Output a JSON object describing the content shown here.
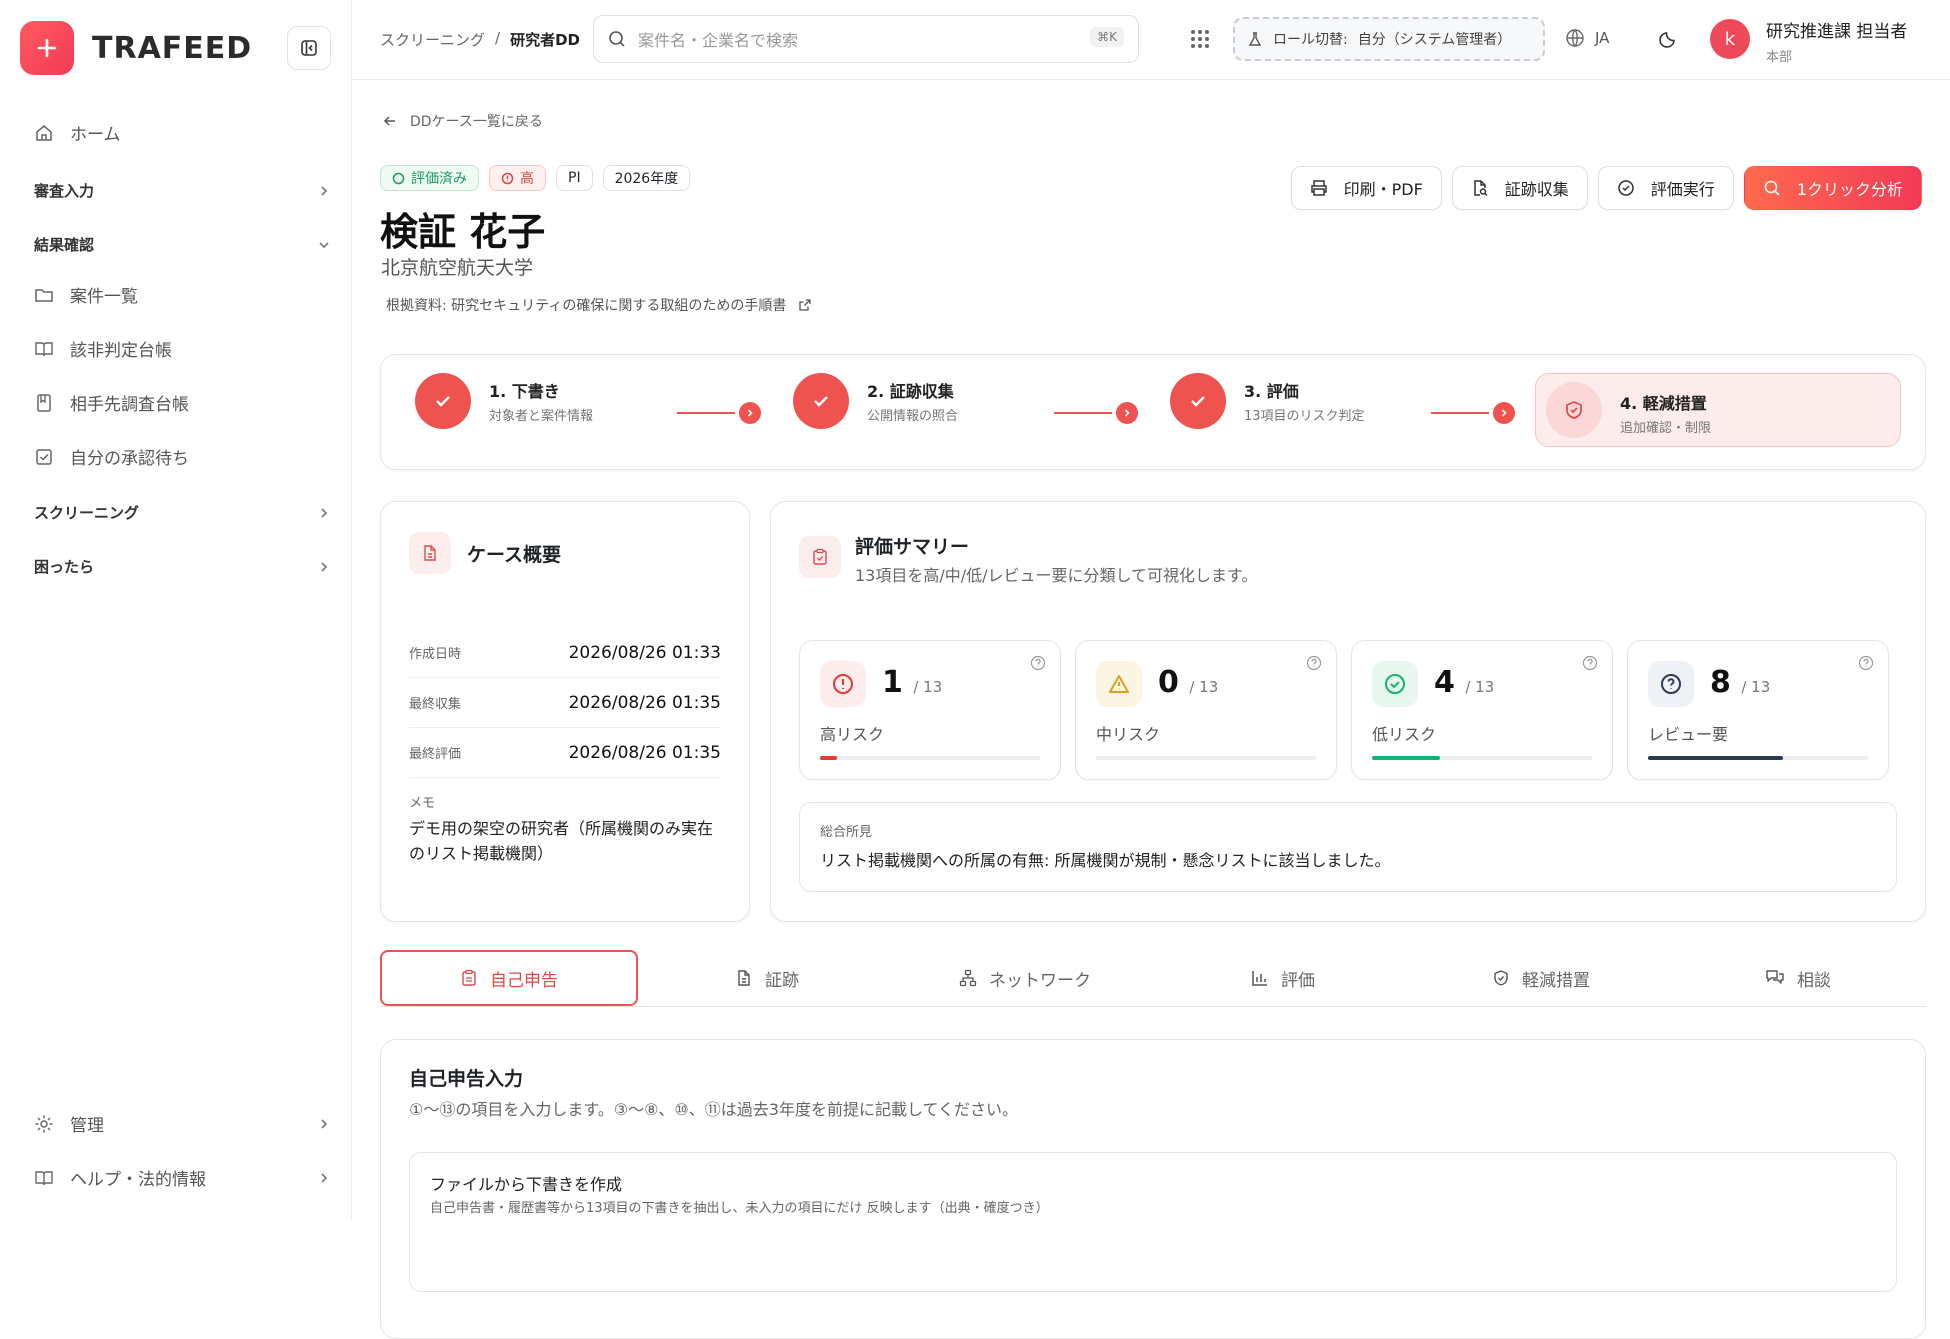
{
  "app": {
    "name": "TRAFEED"
  },
  "sidebar": {
    "home": "ホーム",
    "groups": {
      "review_input": "審査入力",
      "results": "結果確認",
      "screening": "スクリーニング",
      "help_group": "困ったら",
      "admin": "管理",
      "legal": "ヘルプ・法的情報"
    },
    "items": [
      {
        "label": "案件一覧",
        "icon": "folder-icon"
      },
      {
        "label": "該非判定台帳",
        "icon": "book-icon"
      },
      {
        "label": "相手先調査台帳",
        "icon": "ledger-icon"
      },
      {
        "label": "自分の承認待ち",
        "icon": "checkbox-icon"
      }
    ]
  },
  "header": {
    "breadcrumb": [
      "スクリーニング",
      "研究者DD"
    ],
    "breadcrumb_sep": "/",
    "search_placeholder": "案件名・企業名で検索",
    "search_shortcut": "⌘K",
    "role_label": "ロール切替:",
    "role_value": "自分（システム管理者）",
    "lang": "JA",
    "user_initial": "k",
    "user_name": "研究推進課 担当者",
    "user_org": "本部"
  },
  "case": {
    "back_label": "DDケース一覧に戻る",
    "badges": {
      "status": "評価済み",
      "risk": "高",
      "pi": "PI",
      "year": "2026年度"
    },
    "name": "検証 花子",
    "affiliation": "北京航空航天大学",
    "basis": "根拠資料: 研究セキュリティの確保に関する取組のための手順書"
  },
  "actions": {
    "print": "印刷・PDF",
    "collect": "証跡収集",
    "evaluate": "評価実行",
    "analyze": "1クリック分析"
  },
  "steps": [
    {
      "title": "1. 下書き",
      "desc": "対象者と案件情報"
    },
    {
      "title": "2. 証跡収集",
      "desc": "公開情報の照合"
    },
    {
      "title": "3. 評価",
      "desc": "13項目のリスク判定"
    },
    {
      "title": "4. 軽減措置",
      "desc": "追加確認・制限"
    }
  ],
  "overview": {
    "title": "ケース概要",
    "rows": [
      {
        "k": "作成日時",
        "v": "2026/08/26 01:33"
      },
      {
        "k": "最終収集",
        "v": "2026/08/26 01:35"
      },
      {
        "k": "最終評価",
        "v": "2026/08/26 01:35"
      }
    ],
    "memo_label": "メモ",
    "memo": "デモ用の架空の研究者（所属機関のみ実在のリスト掲載機関）"
  },
  "summary": {
    "title": "評価サマリー",
    "subtitle": "13項目を高/中/低/レビュー要に分類して可視化します。",
    "risks": [
      {
        "count": "1",
        "total": "/ 13",
        "label": "高リスク",
        "ratio": 0.077,
        "color": "#e53935",
        "bg": "#fdecec",
        "icon": "alert-circle-icon"
      },
      {
        "count": "0",
        "total": "/ 13",
        "label": "中リスク",
        "ratio": 0,
        "color": "#e0a020",
        "bg": "#fdf5e3",
        "icon": "warning-triangle-icon"
      },
      {
        "count": "4",
        "total": "/ 13",
        "label": "低リスク",
        "ratio": 0.308,
        "color": "#16b277",
        "bg": "#e7f7ef",
        "icon": "check-circle-icon"
      },
      {
        "count": "8",
        "total": "/ 13",
        "label": "レビュー要",
        "ratio": 0.615,
        "color": "#2d3a55",
        "bg": "#eef1f6",
        "icon": "question-circle-icon"
      }
    ],
    "findings_label": "総合所見",
    "findings": "リスト掲載機関への所属の有無: 所属機関が規制・懸念リストに該当しました。"
  },
  "tabs": [
    {
      "label": "自己申告",
      "icon": "clipboard-icon"
    },
    {
      "label": "証跡",
      "icon": "document-icon"
    },
    {
      "label": "ネットワーク",
      "icon": "network-icon"
    },
    {
      "label": "評価",
      "icon": "bar-chart-icon"
    },
    {
      "label": "軽減措置",
      "icon": "shield-icon"
    },
    {
      "label": "相談",
      "icon": "chat-icon"
    }
  ],
  "self_report": {
    "title": "自己申告入力",
    "subtitle": "①〜⑬の項目を入力します。③〜⑧、⑩、⑪は過去3年度を前提に記載してください。",
    "draft_title": "ファイルから下書きを作成",
    "draft_desc": "自己申告書・履歴書等から13項目の下書きを抽出し、未入力の項目にだけ 反映します（出典・確度つき）"
  }
}
